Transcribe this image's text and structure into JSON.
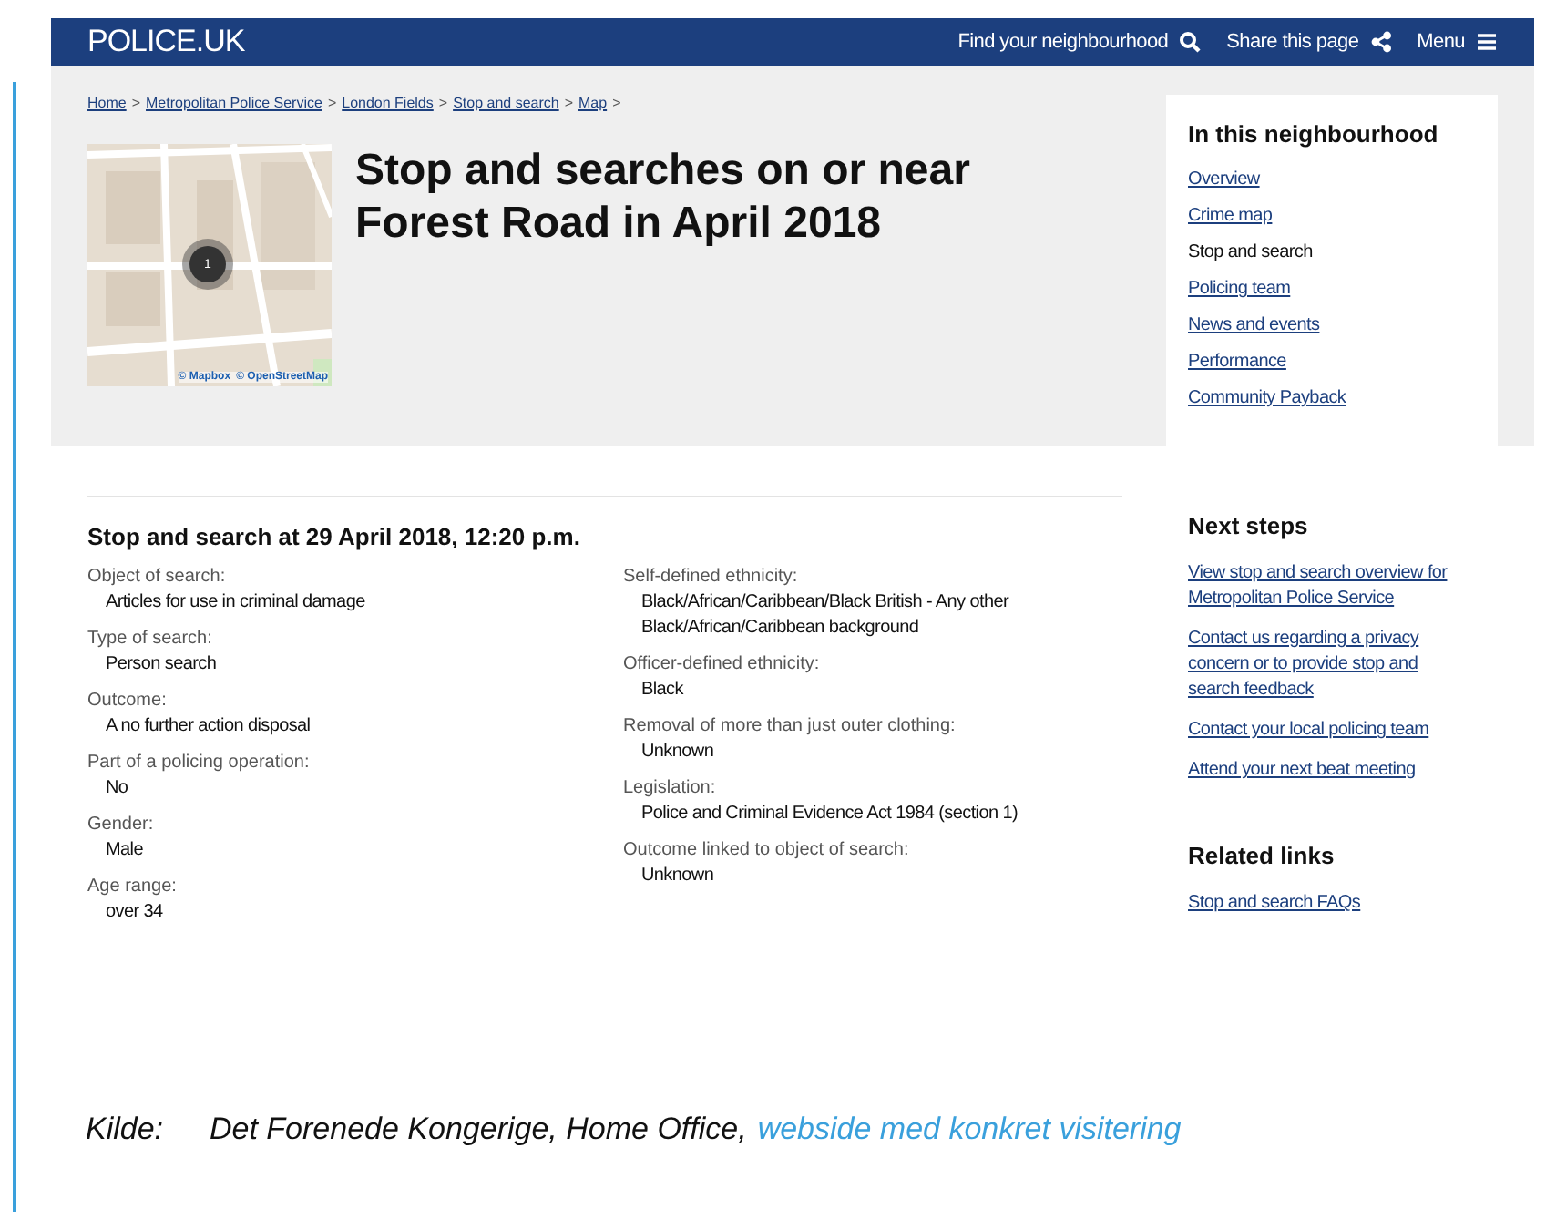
{
  "header": {
    "logo": "POLICE.UK",
    "actions": [
      {
        "label": "Find your neighbourhood",
        "kind": "search"
      },
      {
        "label": "Share this page",
        "kind": "share"
      },
      {
        "label": "Menu",
        "kind": "menu"
      }
    ]
  },
  "breadcrumbs": {
    "separator": ">",
    "items": [
      "Home",
      "Metropolitan Police Service",
      "London Fields",
      "Stop and search",
      "Map"
    ]
  },
  "map": {
    "cluster_count": "1",
    "attribution": [
      "© Mapbox",
      "© OpenStreetMap"
    ]
  },
  "title": "Stop and searches on or near Forest Road in April 2018",
  "record": {
    "heading": "Stop and search at 29 April 2018, 12:20 p.m.",
    "columns": [
      [
        {
          "label": "Object of search:",
          "value": "Articles for use in criminal damage"
        },
        {
          "label": "Type of search:",
          "value": "Person search"
        },
        {
          "label": "Outcome:",
          "value": "A no further action disposal"
        },
        {
          "label": "Part of a policing operation:",
          "value": "No"
        },
        {
          "label": "Gender:",
          "value": "Male"
        },
        {
          "label": "Age range:",
          "value": "over 34"
        }
      ],
      [
        {
          "label": "Self-defined ethnicity:",
          "value": "Black/African/Caribbean/Black British - Any other Black/African/Caribbean background"
        },
        {
          "label": "Officer-defined ethnicity:",
          "value": "Black"
        },
        {
          "label": "Removal of more than just outer clothing:",
          "value": "Unknown"
        },
        {
          "label": "Legislation:",
          "value": "Police and Criminal Evidence Act 1984 (section 1)"
        },
        {
          "label": "Outcome linked to object of search:",
          "value": "Unknown"
        }
      ]
    ]
  },
  "sidebar": {
    "heading": "In this neighbourhood",
    "items": [
      {
        "label": "Overview",
        "selected": false
      },
      {
        "label": "Crime map",
        "selected": false
      },
      {
        "label": "Stop and search",
        "selected": true
      },
      {
        "label": "Policing team",
        "selected": false
      },
      {
        "label": "News and events",
        "selected": false
      },
      {
        "label": "Performance",
        "selected": false
      },
      {
        "label": "Community Payback",
        "selected": false
      }
    ]
  },
  "next_steps": {
    "heading": "Next steps",
    "links": [
      "View stop and search overview for Metropolitan Police Service",
      "Contact us regarding a privacy concern or to provide stop and search feedback",
      "Contact your local policing team",
      "Attend your next beat meeting"
    ]
  },
  "related_links": {
    "heading": "Related links",
    "links": [
      "Stop and search FAQs"
    ]
  },
  "caption": {
    "label": "Kilde:",
    "text": "Det Forenede Kongerige, Home Office,",
    "link": "webside med konkret visitering"
  }
}
